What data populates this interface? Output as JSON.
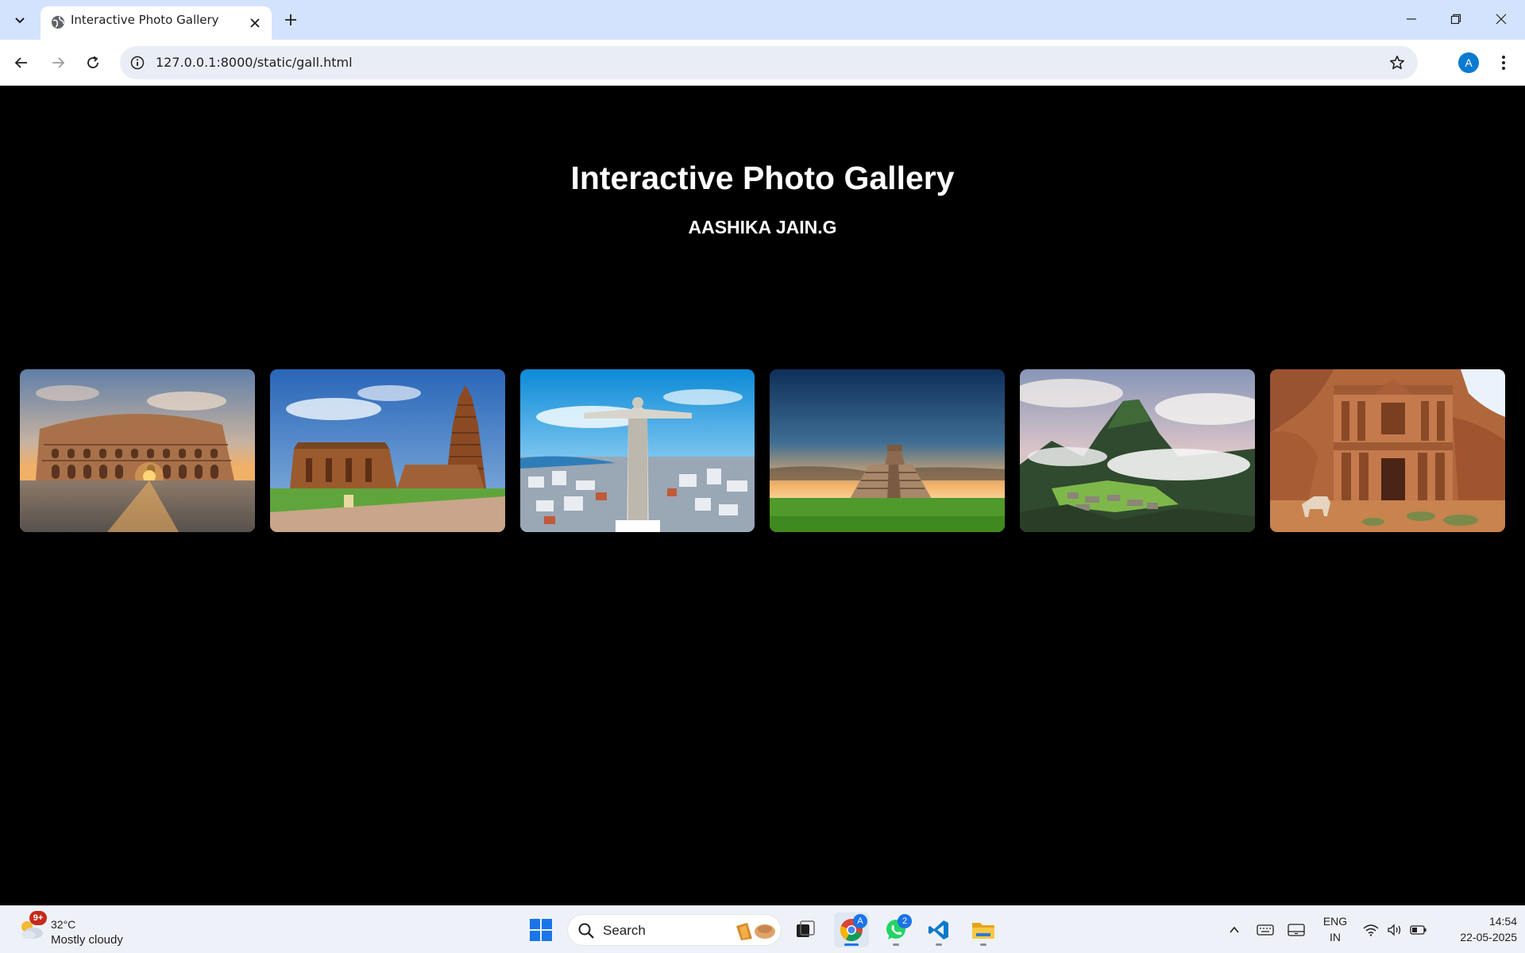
{
  "browser": {
    "tab_title": "Interactive Photo Gallery",
    "url": "127.0.0.1:8000/static/gall.html",
    "profile_initial": "A"
  },
  "page": {
    "title": "Interactive Photo Gallery",
    "subtitle": "AASHIKA JAIN.G",
    "background": "#000000",
    "gallery": [
      {
        "icon": "colosseum-photo"
      },
      {
        "icon": "temple-tower-photo"
      },
      {
        "icon": "christ-statue-photo"
      },
      {
        "icon": "mayan-pyramid-photo"
      },
      {
        "icon": "machu-picchu-photo"
      },
      {
        "icon": "petra-monastery-photo"
      }
    ]
  },
  "taskbar": {
    "weather": {
      "badge": "9+",
      "temperature": "32°C",
      "condition": "Mostly cloudy"
    },
    "search_placeholder": "Search",
    "chrome_badge": "A",
    "whatsapp_badge": "2",
    "language": {
      "line1": "ENG",
      "line2": "IN"
    },
    "clock": {
      "time": "14:54",
      "date": "22-05-2025"
    }
  }
}
